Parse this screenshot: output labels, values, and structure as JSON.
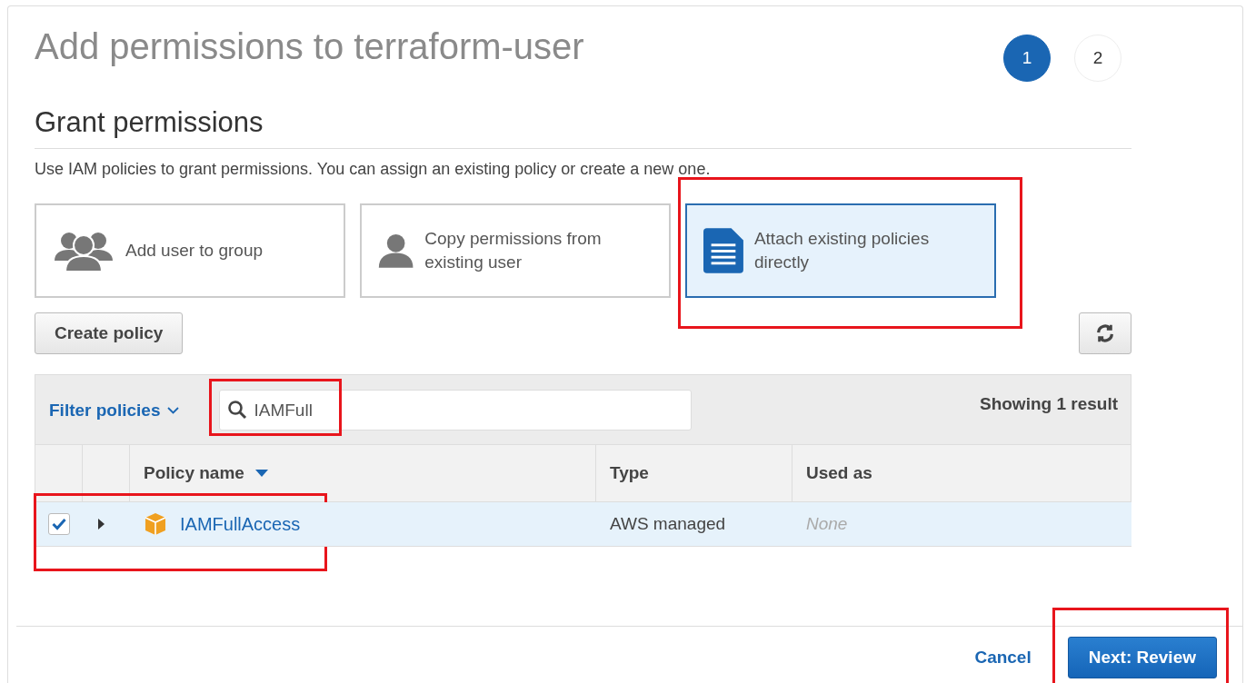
{
  "title": "Add permissions to terraform-user",
  "steps": [
    {
      "label": "1",
      "selected": true
    },
    {
      "label": "2",
      "selected": false
    }
  ],
  "section": {
    "heading": "Grant permissions",
    "description": "Use IAM policies to grant permissions. You can assign an existing policy or create a new one."
  },
  "options": [
    {
      "kind": "group",
      "label": "Add user to group",
      "selected": false,
      "highlighted": false
    },
    {
      "kind": "user",
      "label": "Copy permissions from existing user",
      "selected": false,
      "highlighted": false
    },
    {
      "kind": "document",
      "label": "Attach existing policies directly",
      "selected": true,
      "highlighted": true
    }
  ],
  "create_button": "Create policy",
  "filter": {
    "label": "Filter policies",
    "search_value": "IAMFull",
    "search_highlighted": true,
    "result_count": "Showing 1 result"
  },
  "table": {
    "columns": [
      "Policy name",
      "Type",
      "Used as"
    ],
    "rows": [
      {
        "checked": true,
        "selected": true,
        "expanded": false,
        "highlighted": true,
        "name": "IAMFullAccess",
        "type": "AWS managed",
        "used_as": "None"
      }
    ]
  },
  "footer": {
    "cancel": "Cancel",
    "next": "Next: Review",
    "next_highlighted": true
  }
}
